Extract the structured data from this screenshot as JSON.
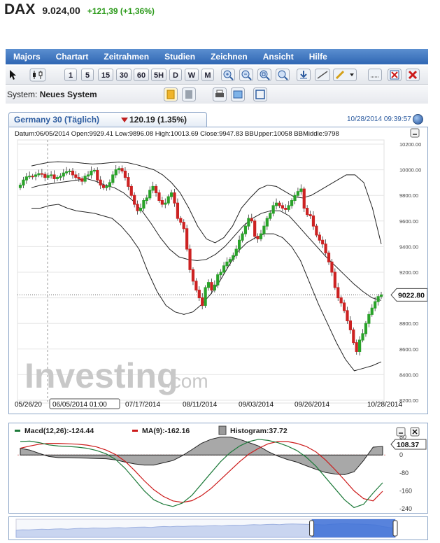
{
  "header": {
    "symbol": "DAX",
    "price": "9.024,00",
    "change": "+121,39 (+1,36%)"
  },
  "menu": [
    "Majors",
    "Chartart",
    "Zeitrahmen",
    "Studien",
    "Zeichnen",
    "Ansicht",
    "Hilfe"
  ],
  "toolbar": {
    "intervals": [
      "1",
      "5",
      "15",
      "30",
      "60",
      "5H",
      "D",
      "W",
      "M"
    ]
  },
  "system": {
    "label": "System:",
    "name": "Neues System"
  },
  "tab": {
    "title": "Germany 30 (Täglich)",
    "value": "120.19 (1.35%)",
    "timestamp": "10/28/2014 09:39:57"
  },
  "colors": {
    "up": "#2aa22a",
    "down": "#cc2222",
    "macd": "#1d7a3a",
    "signal": "#cc1a1a",
    "histogram": "#9a9a9a",
    "navfill": "#3c6fd6"
  },
  "chart_data": [
    {
      "type": "candlestick",
      "info_line": {
        "Datum": "06/05/2014",
        "Open": "9929.41",
        "Low": "9896.08",
        "High": "10013.69",
        "Close": "9947.83",
        "BBUpper": "10058",
        "BBMiddle": "9798"
      },
      "watermark": "Investing.com",
      "ylim": [
        8200,
        10200
      ],
      "yticks": [
        "10200.00",
        "10000.00",
        "9800.00",
        "9600.00",
        "9400.00",
        "9200.00",
        "9000.00",
        "8800.00",
        "8600.00",
        "8400.00",
        "8200.00"
      ],
      "xticks": [
        "05/26/20",
        "06/05/2014 01:00",
        "07/17/2014",
        "08/11/2014",
        "09/03/2014",
        "09/26/2014",
        "10/28/2014"
      ],
      "last_price_label": "9022.80",
      "last_price": 9022.8,
      "close": [
        9880,
        9920,
        9945,
        9950,
        9948,
        9960,
        9970,
        9965,
        9940,
        9955,
        9960,
        9930,
        9940,
        9950,
        9975,
        9985,
        9990,
        9960,
        9940,
        9930,
        9910,
        9950,
        9960,
        9990,
        9995,
        9920,
        9880,
        9860,
        9870,
        9900,
        9960,
        10000,
        10010,
        9990,
        9940,
        9870,
        9800,
        9730,
        9680,
        9700,
        9760,
        9780,
        9840,
        9870,
        9820,
        9760,
        9730,
        9740,
        9790,
        9820,
        9740,
        9620,
        9590,
        9540,
        9380,
        9220,
        9130,
        9060,
        9000,
        8940,
        9080,
        9120,
        9060,
        9100,
        9180,
        9200,
        9250,
        9280,
        9300,
        9330,
        9380,
        9450,
        9500,
        9560,
        9620,
        9600,
        9480,
        9460,
        9500,
        9560,
        9620,
        9660,
        9720,
        9740,
        9720,
        9700,
        9690,
        9720,
        9760,
        9800,
        9830,
        9850,
        9700,
        9650,
        9640,
        9560,
        9490,
        9450,
        9420,
        9350,
        9280,
        9200,
        9080,
        9000,
        8960,
        8900,
        8820,
        8750,
        8650,
        8580,
        8670,
        8720,
        8800,
        8870,
        8920,
        8970,
        9010,
        9022.8
      ],
      "bollinger": {
        "upper": [
          10030,
          10045,
          10058,
          10063,
          10060,
          10058,
          10050,
          10045,
          10048,
          10055,
          10060,
          10055,
          10040,
          10020,
          10000,
          9960,
          9900,
          9820,
          9700,
          9560,
          9460,
          9430,
          9470,
          9560,
          9700,
          9780,
          9850,
          9880,
          9870,
          9830,
          9790,
          9780,
          9800,
          9840,
          9880,
          9920,
          9960,
          9960,
          9900,
          9700,
          9420
        ],
        "middle": [
          9860,
          9880,
          9890,
          9900,
          9910,
          9920,
          9930,
          9910,
          9880,
          9860,
          9820,
          9760,
          9680,
          9580,
          9470,
          9380,
          9320,
          9300,
          9290,
          9300,
          9340,
          9400,
          9480,
          9560,
          9620,
          9660,
          9680,
          9680,
          9640,
          9560,
          9480,
          9400,
          9320,
          9250,
          9180,
          9110,
          9050,
          9000,
          8980
        ],
        "lower": [
          9700,
          9700,
          9720,
          9730,
          9700,
          9680,
          9670,
          9660,
          9640,
          9620,
          9560,
          9480,
          9380,
          9200,
          9050,
          8940,
          8890,
          8870,
          8890,
          8950,
          9030,
          9130,
          9250,
          9360,
          9430,
          9470,
          9500,
          9500,
          9470,
          9400,
          9290,
          9120,
          8950,
          8800,
          8650,
          8520,
          8430,
          8450,
          8470,
          8500
        ]
      }
    },
    {
      "type": "line",
      "legend": [
        {
          "name": "Macd(12,26)",
          "value": "-124.44"
        },
        {
          "name": "MA(9)",
          "value": "-162.16"
        },
        {
          "name": "Histogram",
          "value": "37.72"
        }
      ],
      "ylim": [
        -240,
        60
      ],
      "yticks": [
        "80",
        "0",
        "-80",
        "-160",
        "-240"
      ],
      "last_value_label": "108.37",
      "macd": [
        60,
        62,
        55,
        45,
        40,
        38,
        35,
        30,
        20,
        5,
        -20,
        -60,
        -110,
        -160,
        -200,
        -220,
        -230,
        -215,
        -180,
        -130,
        -80,
        -30,
        10,
        40,
        60,
        70,
        65,
        55,
        40,
        20,
        -10,
        -50,
        -100,
        -150,
        -200,
        -235,
        -220,
        -170,
        -124
      ],
      "signal": [
        30,
        40,
        48,
        52,
        52,
        50,
        48,
        44,
        36,
        22,
        2,
        -28,
        -70,
        -115,
        -155,
        -185,
        -205,
        -212,
        -204,
        -182,
        -150,
        -110,
        -70,
        -30,
        5,
        30,
        50,
        60,
        60,
        52,
        38,
        14,
        -22,
        -65,
        -112,
        -160,
        -195,
        -205,
        -162
      ],
      "histogram": [
        30,
        22,
        7,
        -7,
        -12,
        -12,
        -13,
        -14,
        -16,
        -17,
        -22,
        -32,
        -40,
        -45,
        -45,
        -35,
        -25,
        -3,
        24,
        52,
        70,
        80,
        80,
        70,
        55,
        40,
        15,
        -5,
        -20,
        -32,
        -48,
        -64,
        -78,
        -85,
        -88,
        -75,
        -25,
        35,
        38
      ]
    },
    {
      "type": "area",
      "values": [
        40,
        42,
        41,
        43,
        45,
        44,
        46,
        47,
        45,
        48,
        50,
        49,
        52,
        51,
        50,
        53,
        54,
        52,
        55,
        56,
        57,
        55,
        58,
        60,
        59,
        61,
        60,
        62,
        63,
        62,
        64,
        65,
        63,
        66,
        67,
        66,
        68,
        70,
        69,
        71,
        72,
        70,
        73,
        74,
        73,
        72,
        71,
        70,
        69,
        72,
        74,
        75,
        74,
        73,
        72,
        70,
        68,
        60,
        55,
        50
      ]
    }
  ]
}
